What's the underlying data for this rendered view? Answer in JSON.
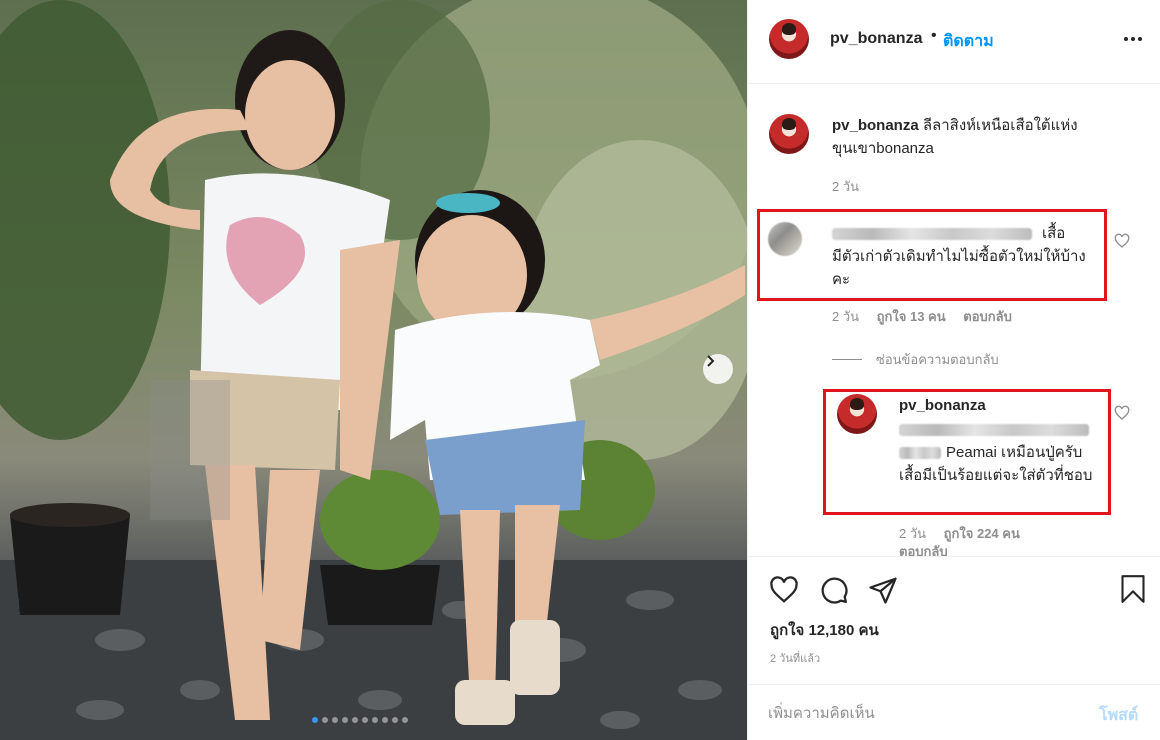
{
  "header": {
    "username": "pv_bonanza",
    "separator": "•",
    "follow_label": "ติดตาม",
    "more_icon": "more-horizontal-icon"
  },
  "caption": {
    "username": "pv_bonanza",
    "text": "ลีลาสิงห์เหนือเสือใต้แห่งขุนเขาbonanza",
    "time": "2 วัน"
  },
  "comments": [
    {
      "text_line1": "เสื้อ",
      "text_rest": "มีตัวเก่าตัวเดิมทำไมไม่ซื้อตัวใหม่ให้บ้างคะ",
      "time": "2 วัน",
      "likes": "ถูกใจ 13 คน",
      "reply_label": "ตอบกลับ"
    }
  ],
  "hide_replies_label": "ซ่อนข้อความตอบกลับ",
  "reply": {
    "username": "pv_bonanza",
    "text_line1": "Peamai เหมือนปู่ครับ",
    "text_rest": "เสื้อมีเป็นร้อยแต่จะใส่ตัวที่ชอบ",
    "time": "2 วัน",
    "likes": "ถูกใจ 224 คน",
    "reply_label": "ตอบกลับ"
  },
  "actions": {
    "likes_text": "ถูกใจ 12,180 คน",
    "post_time": "2 วันที่แล้ว"
  },
  "add_comment": {
    "placeholder": "เพิ่มความคิดเห็น",
    "post_label": "โพสต์"
  },
  "carousel": {
    "total": 10,
    "active": 0
  },
  "colors": {
    "accent": "#0095f6",
    "highlight_box": "#e0141b",
    "post_disabled": "#b3dbff"
  }
}
